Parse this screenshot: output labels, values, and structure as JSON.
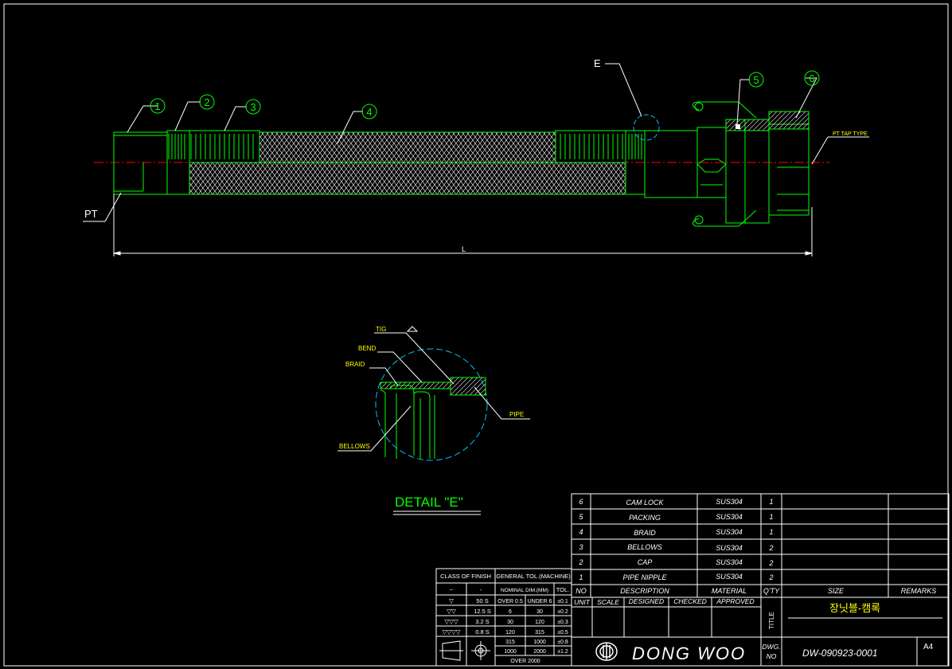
{
  "colors": {
    "background": "#000000",
    "outline": "#00ff00",
    "dimension": "#ffffff",
    "annotation": "#ffff00",
    "centerline": "#ff0000",
    "detail_circle": "#00c0ff",
    "title_text": "#00ff00"
  },
  "main_view": {
    "balloons": [
      "1",
      "2",
      "3",
      "4",
      "5",
      "6"
    ],
    "label_e": "E",
    "label_pt": "PT",
    "label_pt_tap": "PT TAP TYPE",
    "dim_l": "L"
  },
  "detail": {
    "title": "DETAIL \"E\"",
    "labels": {
      "tig": "TIG",
      "bend": "BEND",
      "braid": "BRAID",
      "pipe": "PIPE",
      "bellows": "BELLOWS"
    }
  },
  "bom": {
    "rows": [
      {
        "no": "6",
        "desc": "CAM LOCK",
        "mat": "SUS304",
        "qty": "1"
      },
      {
        "no": "5",
        "desc": "PACKING",
        "mat": "SUS304",
        "qty": "1"
      },
      {
        "no": "4",
        "desc": "BRAID",
        "mat": "SUS304",
        "qty": "1"
      },
      {
        "no": "3",
        "desc": "BELLOWS",
        "mat": "SUS304",
        "qty": "2"
      },
      {
        "no": "2",
        "desc": "CAP",
        "mat": "SUS304",
        "qty": "2"
      },
      {
        "no": "1",
        "desc": "PIPE NIPPLE",
        "mat": "SUS304",
        "qty": "2"
      }
    ],
    "header": {
      "no": "NO",
      "desc": "DESCRIPTION",
      "mat": "MATERIAL",
      "qty": "Q'TY",
      "size": "SIZE",
      "remarks": "REMARKS"
    }
  },
  "approval": {
    "unit": "UNIT",
    "scale": "SCALE",
    "designed": "DESIGNED",
    "checked": "CHECKED",
    "approved": "APPROVED",
    "title_label": "TITLE",
    "title_value": "장닛블-캠록",
    "company": "DONG WOO",
    "dwg_label_1": "DWG.",
    "dwg_label_2": "NO",
    "dwg_no": "DW-090923-0001",
    "sheet": "A4"
  },
  "tolerance": {
    "col1_header": "CLASS OF FINISH",
    "col2_header": "GENERAL TOL.(MACHINE)",
    "sub_header": {
      "sym": "~",
      "dash": "-",
      "nominal": "NOMINAL DIM.(MM)",
      "tol": "TOL."
    },
    "finish": [
      {
        "sym": "▽",
        "val": "50 S"
      },
      {
        "sym": "▽▽",
        "val": "12.5 S"
      },
      {
        "sym": "▽▽▽",
        "val": "3.2 S"
      },
      {
        "sym": "▽▽▽▽",
        "val": "0.8 S"
      }
    ],
    "rows": [
      {
        "over": "OVER 0.5",
        "under": "UNDER 6",
        "tol": "±0.1"
      },
      {
        "over": "6",
        "under": "30",
        "tol": "±0.2"
      },
      {
        "over": "30",
        "under": "120",
        "tol": "±0.3"
      },
      {
        "over": "120",
        "under": "315",
        "tol": "±0.5"
      },
      {
        "over": "315",
        "under": "1000",
        "tol": "±0.8"
      },
      {
        "over": "1000",
        "under": "2000",
        "tol": "±1.2"
      }
    ],
    "last_row": "OVER 2000"
  }
}
